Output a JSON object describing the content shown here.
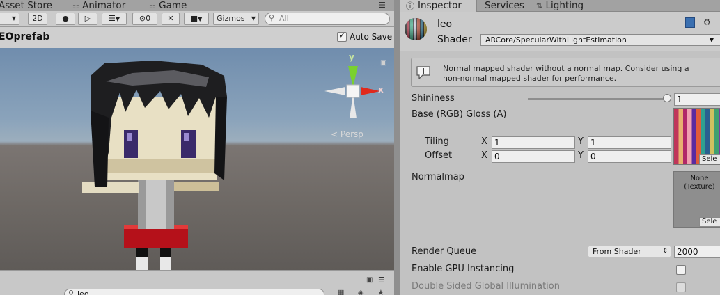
{
  "left_tabs": [
    {
      "label": "Asset Store",
      "icon": "asset-store-icon"
    },
    {
      "label": "Animator",
      "icon": "animator-icon"
    },
    {
      "label": "Game",
      "icon": "game-icon"
    }
  ],
  "toolbar": {
    "mode_2d": "2D",
    "hidden_count": "0",
    "gizmos_label": "Gizmos",
    "search_placeholder": "All"
  },
  "scene": {
    "prefab_title": "EOprefab",
    "auto_save_label": "Auto Save",
    "auto_save_checked": true,
    "gizmo_axis_y": "y",
    "gizmo_axis_x": "x",
    "projection_label": "Persp"
  },
  "project_search": {
    "value": "leo"
  },
  "right_tabs": [
    {
      "label": "Inspector",
      "icon": "info-icon"
    },
    {
      "label": "Services",
      "icon": ""
    },
    {
      "label": "Lighting",
      "icon": "lighting-icon"
    }
  ],
  "material": {
    "name": "leo",
    "shader_label": "Shader",
    "shader_value": "ARCore/SpecularWithLightEstimation"
  },
  "warning": {
    "line1": "Normal mapped shader without a normal map. Consider using a",
    "line2": "non-normal mapped shader for performance."
  },
  "properties": {
    "shininess_label": "Shininess",
    "shininess_value": "1",
    "shininess_fraction": 1.0,
    "base_label": "Base (RGB) Gloss (A)",
    "tiling_label": "Tiling",
    "offset_label": "Offset",
    "axis_x": "X",
    "axis_y": "Y",
    "tiling_x": "1",
    "tiling_y": "1",
    "offset_x": "0",
    "offset_y": "0",
    "select_label": "Sele",
    "normalmap_label": "Normalmap",
    "normalmap_none_line1": "None",
    "normalmap_none_line2": "(Texture)",
    "render_queue_label": "Render Queue",
    "render_queue_mode": "From Shader",
    "render_queue_value": "2000",
    "gpu_instancing_label": "Enable GPU Instancing",
    "gpu_instancing_checked": false,
    "double_sided_label": "Double Sided Global Illumination",
    "double_sided_checked": false
  },
  "colors": {
    "sky_top": "#708dad",
    "ground": "#6e6965",
    "gizmo_y": "#7ad12e",
    "gizmo_x": "#e0291c",
    "inspector_bg": "#c2c2c2"
  }
}
